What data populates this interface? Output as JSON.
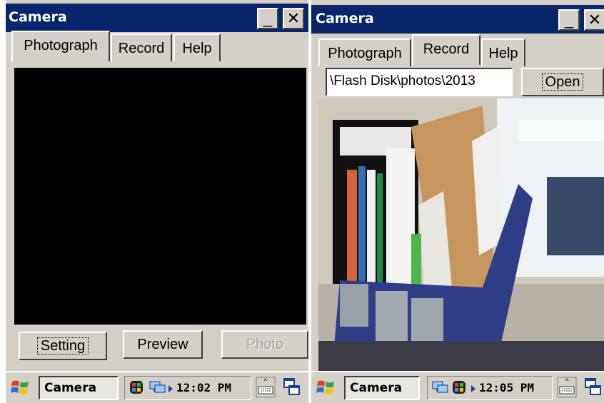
{
  "left": {
    "title": "Camera",
    "minimize_glyph": "_",
    "close_glyph": "✕",
    "tabs": [
      "Photograph",
      "Record",
      "Help"
    ],
    "active_tab": "Photograph",
    "buttons": {
      "setting": "Setting",
      "preview": "Preview",
      "photo": "Photo"
    },
    "taskbar": {
      "task": "Camera",
      "time": "12:02 PM"
    }
  },
  "right": {
    "title": "Camera",
    "minimize_glyph": "_",
    "close_glyph": "✕",
    "tabs": [
      "Photograph",
      "Record",
      "Help"
    ],
    "active_tab": "Record",
    "path": "\\Flash Disk\\photos\\2013",
    "open_label": "Open",
    "taskbar": {
      "task": "Camera",
      "time": "12:05 PM"
    }
  },
  "icons": {
    "start": "windows-flag-icon",
    "network": "network-icon",
    "tray": "tray-status-icon",
    "keyboard": "keyboard-icon",
    "desktop": "show-desktop-icon"
  }
}
